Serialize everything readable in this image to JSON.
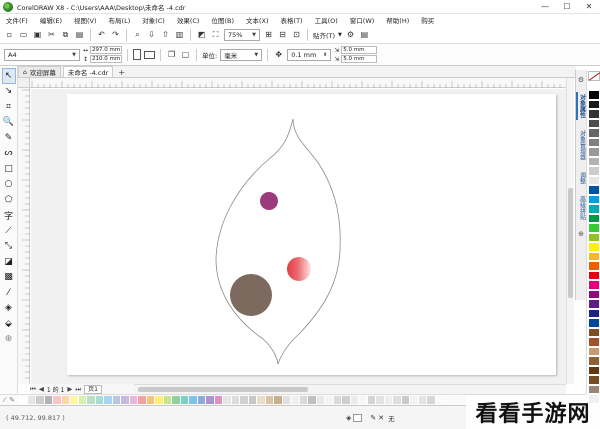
{
  "window": {
    "title": "CorelDRAW X8 - C:\\Users\\AAA\\Desktop\\未命名 -4.cdr",
    "minimize": "—",
    "maximize": "☐",
    "close": "✕"
  },
  "menu": [
    "文件(F)",
    "编辑(E)",
    "视图(V)",
    "布局(L)",
    "对象(C)",
    "效果(C)",
    "位图(B)",
    "文本(X)",
    "表格(T)",
    "工具(O)",
    "窗口(W)",
    "帮助(H)",
    "购买"
  ],
  "toolbar": {
    "zoom_value": "75%",
    "snap_label": "贴齐(T)"
  },
  "property_bar": {
    "page_size": "A4",
    "width": "297.0 mm",
    "height": "210.0 mm",
    "units_label": "单位:",
    "units_value": "毫米",
    "nudge": "0.1 mm",
    "dup_x": "5.0 mm",
    "dup_y": "5.0 mm"
  },
  "tabs": {
    "welcome": "欢迎屏幕",
    "document": "未命名 -4.cdr"
  },
  "tools": [
    {
      "name": "pick-tool",
      "glyph": "↖"
    },
    {
      "name": "shape-tool",
      "glyph": "↘"
    },
    {
      "name": "crop-tool",
      "glyph": "⌗"
    },
    {
      "name": "zoom-tool",
      "glyph": "🔍"
    },
    {
      "name": "freehand-tool",
      "glyph": "✎"
    },
    {
      "name": "artistic-media-tool",
      "glyph": "ᔕ"
    },
    {
      "name": "rectangle-tool",
      "glyph": "□"
    },
    {
      "name": "ellipse-tool",
      "glyph": "○"
    },
    {
      "name": "polygon-tool",
      "glyph": "⬠"
    },
    {
      "name": "text-tool",
      "glyph": "字"
    },
    {
      "name": "parallel-dimension-tool",
      "glyph": "⟋"
    },
    {
      "name": "connector-tool",
      "glyph": "⤡"
    },
    {
      "name": "drop-shadow-tool",
      "glyph": "◪"
    },
    {
      "name": "transparency-tool",
      "glyph": "▩"
    },
    {
      "name": "eyedropper-tool",
      "glyph": "⁄"
    },
    {
      "name": "interactive-fill-tool",
      "glyph": "◈"
    },
    {
      "name": "smart-fill-tool",
      "glyph": "⬙"
    }
  ],
  "dockers": [
    "对象属性",
    "对象管理器",
    "调整",
    "高级拼贴"
  ],
  "palette_colors": [
    "#ffffff",
    "#000000",
    "#1a1a1a",
    "#333333",
    "#4d4d4d",
    "#666666",
    "#808080",
    "#999999",
    "#b3b3b3",
    "#cccccc",
    "#e6e6e6",
    "#0055a5",
    "#00a0e9",
    "#00b0b0",
    "#009944",
    "#33cc33",
    "#8fc31f",
    "#fff100",
    "#f8b62b",
    "#eb6100",
    "#e60012",
    "#e4007f",
    "#920783",
    "#601986",
    "#1d2088",
    "#00479d",
    "#7f4f21",
    "#a0522d",
    "#c69c6d",
    "#8c6239",
    "#603813",
    "#754c24",
    "#998675",
    "#736357",
    "#534741"
  ],
  "bottom_palette": [
    "#ffffff",
    "#e6e6e6",
    "#cccccc",
    "#b3b3b3",
    "#f7c6c7",
    "#fbd7a5",
    "#fff7a8",
    "#d7f0b0",
    "#b8e0c2",
    "#a8dcd9",
    "#a7d4f0",
    "#b5c7e8",
    "#c9b8de",
    "#e8b8d8",
    "#f2a0a1",
    "#f9c27b",
    "#fff07a",
    "#c5e58a",
    "#8fd19e",
    "#7fcdc8",
    "#7ec2ec",
    "#8ea9dd",
    "#aa93cf",
    "#dc92c3",
    "#e6e6e6",
    "#dddddd",
    "#d0d0d0",
    "#c8c8c8",
    "#e9dcc9",
    "#d8c3a5",
    "#c8b08c",
    "#e0e0e0",
    "#f0f0f0",
    "#d9d9d9",
    "#c0c0c0",
    "#e8e8e8",
    "#f4f4f4",
    "#dadada",
    "#cfcfcf",
    "#ebebeb",
    "#f7f7f7",
    "#d4d4d4",
    "#e2e2e2",
    "#eeeeee",
    "#dedede",
    "#cacaca",
    "#f2f2f2",
    "#e4e4e4",
    "#d6d6d6",
    "#fafafa"
  ],
  "page_nav": {
    "first": "⏮",
    "prev": "◀",
    "count": "1 的 1",
    "next": "▶",
    "last": "⏭",
    "page_tab": "页1"
  },
  "status": {
    "coords": "( 49.712, 99.817 )",
    "outline": "无"
  },
  "drawing": {
    "circles": [
      {
        "name": "purple-circle",
        "color": "#9b3b7e"
      },
      {
        "name": "red-gradient-circle",
        "color": "#e33b44"
      },
      {
        "name": "brown-circle",
        "color": "#7d6a5f"
      }
    ],
    "leaf_outline_color": "#8a8a8a"
  },
  "watermark": "看看手游网"
}
